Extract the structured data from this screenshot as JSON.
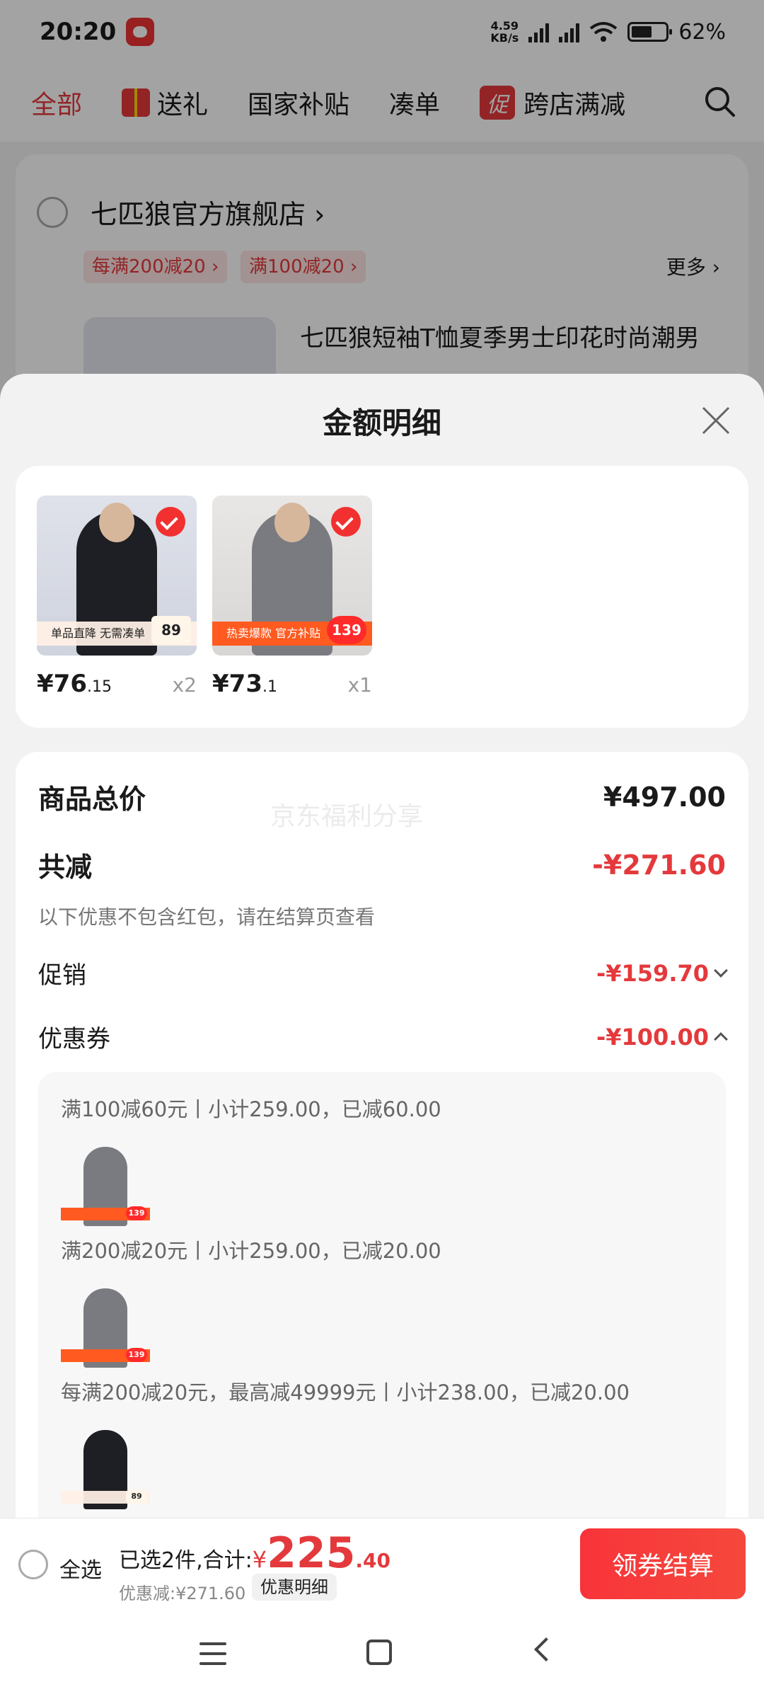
{
  "status_bar": {
    "time": "20:20",
    "net_speed_top": "4.59",
    "net_speed_unit": "KB/s",
    "battery": "62%"
  },
  "tabs": [
    {
      "label": "全部",
      "active": true
    },
    {
      "label": "送礼"
    },
    {
      "label": "国家补贴"
    },
    {
      "label": "凑单"
    },
    {
      "label": "跨店满减",
      "badge": "促"
    }
  ],
  "store": {
    "name": "七匹狼官方旗舰店 ›",
    "tags": [
      "每满200减20 ›",
      "满100减20 ›"
    ],
    "more": "更多 ›",
    "product_title": "七匹狼短袖T恤夏季男士印花时尚潮男"
  },
  "sheet": {
    "title": "金额明细",
    "products": [
      {
        "price_int": "¥76",
        "price_dec": ".15",
        "qty": "x2",
        "strip": "单品直降 无需凑单",
        "chip": "89"
      },
      {
        "price_int": "¥73",
        "price_dec": ".1",
        "qty": "x1",
        "strip": "热卖爆款 官方补贴",
        "chip": "139"
      }
    ],
    "watermark": "京东福利分享",
    "total_label": "商品总价",
    "total_value": "¥497.00",
    "reduce_label": "共减",
    "reduce_value": "-¥271.60",
    "reduce_note": "以下优惠不包含红包，请在结算页查看",
    "promo_label": "促销",
    "promo_value": "-¥159.70",
    "coupon_label": "优惠券",
    "coupon_value": "-¥100.00",
    "coupon_lines": [
      "满100减60元丨小计259.00，已减60.00",
      "满200减20元丨小计259.00，已减20.00",
      "每满200减20元，最高减49999元丨小计238.00，已减20.00"
    ],
    "coupon_chips": [
      "139",
      "139",
      "89"
    ]
  },
  "bottom_bar": {
    "select_all": "全选",
    "selected": "已选2件,合计:",
    "yen": "¥",
    "total_int": "225",
    "total_dec": ".40",
    "saved": "优惠减:¥271.60",
    "detail_button": "优惠明细",
    "checkout": "领券结算"
  },
  "colors": {
    "accent": "#e4393c",
    "checkout": "#f8343a"
  }
}
